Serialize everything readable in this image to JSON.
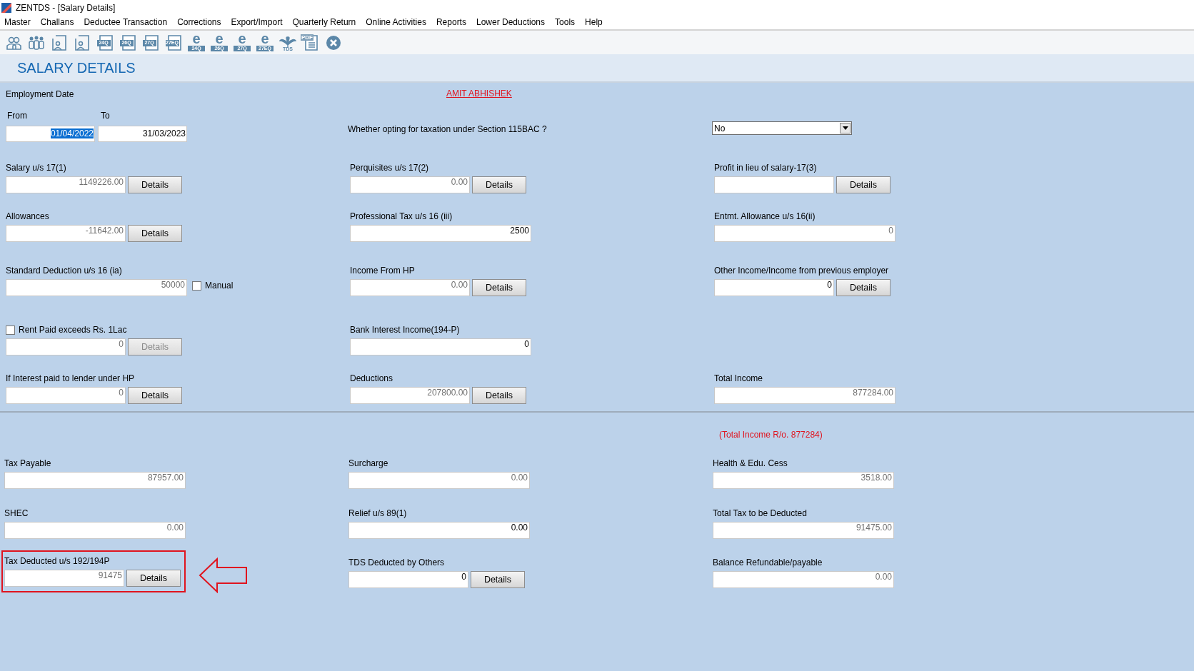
{
  "window": {
    "title": "ZENTDS - [Salary Details]"
  },
  "menu": [
    "Master",
    "Challans",
    "Deductee Transaction",
    "Corrections",
    "Export/Import",
    "Quarterly Return",
    "Online Activities",
    "Reports",
    "Lower Deductions",
    "Tools",
    "Help"
  ],
  "toolbar": [
    {
      "kind": "pair"
    },
    {
      "kind": "group"
    },
    {
      "kind": "doc-person"
    },
    {
      "kind": "doc-person"
    },
    {
      "kind": "form",
      "label": "24Q"
    },
    {
      "kind": "form",
      "label": "26Q"
    },
    {
      "kind": "form",
      "label": "27Q"
    },
    {
      "kind": "form",
      "label": "27EQ"
    },
    {
      "kind": "e-form",
      "mark": "e",
      "label": "24Q"
    },
    {
      "kind": "e-form",
      "mark": "e",
      "label": "26Q"
    },
    {
      "kind": "e-form",
      "mark": "e",
      "label": "27Q"
    },
    {
      "kind": "e-form",
      "mark": "e",
      "label": "27EQ"
    },
    {
      "kind": "tds",
      "label": "TDS"
    },
    {
      "kind": "pdf",
      "label": "PDF"
    },
    {
      "kind": "close"
    }
  ],
  "page_title": "SALARY DETAILS",
  "employment": {
    "label": "Employment Date",
    "from_label": "From",
    "to_label": "To",
    "from": "01/04/2022",
    "from_selected": true,
    "to": "31/03/2023"
  },
  "employee_name": "AMIT ABHISHEK",
  "regime": {
    "question": "Whether opting for taxation under Section 115BAC ?",
    "value": "No"
  },
  "income_rows": [
    {
      "cells": [
        {
          "kind": "amount",
          "label": "Salary u/s 17(1)",
          "value": "1149226.00",
          "readonly": true,
          "button": {
            "label": "Details",
            "disabled": false
          }
        },
        {
          "kind": "amount",
          "label": "Perquisites u/s 17(2)",
          "value": "0.00",
          "readonly": true,
          "button": {
            "label": "Details",
            "disabled": false
          }
        },
        {
          "kind": "amount",
          "label": "Profit in lieu of salary-17(3)",
          "button": {
            "label": "Details",
            "disabled": false
          }
        }
      ]
    },
    {
      "cells": [
        {
          "kind": "amount",
          "label": "Allowances",
          "value": "-11642.00",
          "readonly": true,
          "button": {
            "label": "Details",
            "disabled": false
          }
        },
        {
          "kind": "amount",
          "label": "Professional Tax u/s 16 (iii)",
          "value": "2500",
          "readonly": false
        },
        {
          "kind": "amount",
          "label": "Entmt. Allowance u/s 16(ii)",
          "value": "0",
          "readonly": true
        }
      ]
    },
    {
      "cells": [
        {
          "kind": "amount-check",
          "label": "Standard Deduction u/s 16 (ia)",
          "value": "50000",
          "readonly": true,
          "check_label": "Manual",
          "checked": false
        },
        {
          "kind": "amount",
          "label": "Income From HP",
          "value": "0.00",
          "readonly": true,
          "button": {
            "label": "Details",
            "disabled": false
          }
        },
        {
          "kind": "amount",
          "label": "Other Income/Income from previous employer",
          "value": "0",
          "readonly": false,
          "button": {
            "label": "Details",
            "disabled": false
          }
        }
      ]
    },
    {
      "cells": [
        {
          "kind": "check-amount",
          "label": "Rent Paid exceeds Rs.  1Lac",
          "checked": false,
          "value": "0",
          "readonly": true,
          "button": {
            "label": "Details",
            "disabled": true
          }
        },
        {
          "kind": "amount",
          "label": "Bank Interest Income(194-P)",
          "value": "0",
          "readonly": false
        }
      ]
    },
    {
      "cells": [
        {
          "kind": "amount",
          "label": "If Interest paid to lender under HP",
          "value": "0",
          "readonly": true,
          "button": {
            "label": "Details",
            "disabled": false
          }
        },
        {
          "kind": "amount",
          "label": "Deductions",
          "value": "207800.00",
          "readonly": true,
          "button": {
            "label": "Details",
            "disabled": false
          }
        },
        {
          "kind": "amount",
          "label": "Total Income",
          "value": "877284.00",
          "readonly": true
        }
      ]
    }
  ],
  "total_income_note": "(Total Income R/o. 877284)",
  "tax_rows": [
    {
      "cells": [
        {
          "kind": "amount",
          "label": "Tax Payable",
          "value": "87957.00",
          "readonly": true
        },
        {
          "kind": "amount",
          "label": "Surcharge",
          "value": "0.00",
          "readonly": true
        },
        {
          "kind": "amount",
          "label": "Health & Edu. Cess",
          "value": "3518.00",
          "readonly": true
        }
      ]
    },
    {
      "cells": [
        {
          "kind": "amount",
          "label": "SHEC",
          "value": "0.00",
          "readonly": true
        },
        {
          "kind": "amount",
          "label": "Relief u/s 89(1)",
          "value": "0.00",
          "readonly": false
        },
        {
          "kind": "amount",
          "label": "Total Tax to be Deducted",
          "value": "91475.00",
          "readonly": true
        }
      ]
    },
    {
      "cells": [
        {
          "kind": "amount",
          "label": "Tax Deducted u/s 192/194P",
          "value": "91475",
          "readonly": true,
          "highlighted": true,
          "button": {
            "label": "Details",
            "disabled": false
          }
        },
        {
          "kind": "amount",
          "label": "TDS Deducted by Others",
          "value": "0",
          "readonly": false,
          "button": {
            "label": "Details",
            "disabled": false
          }
        },
        {
          "kind": "amount",
          "label": "Balance Refundable/payable",
          "value": "0.00",
          "readonly": true
        }
      ]
    }
  ]
}
